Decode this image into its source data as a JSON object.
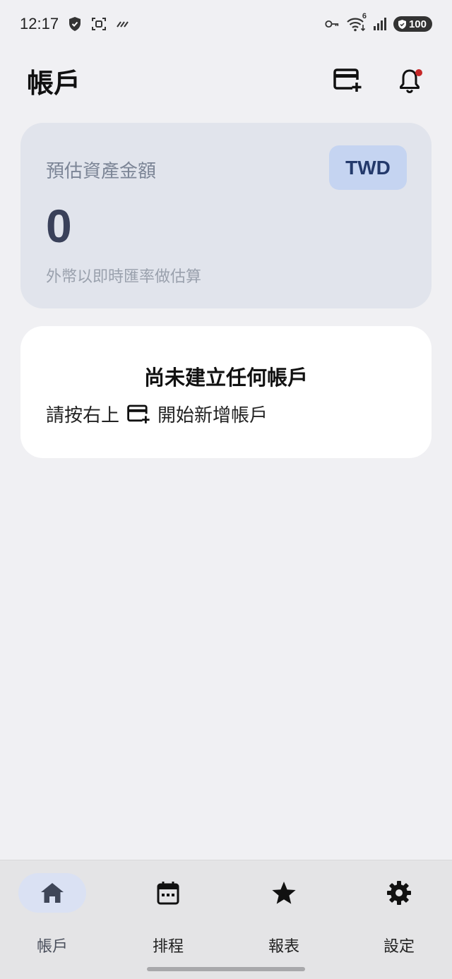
{
  "status_bar": {
    "time": "12:17",
    "battery": "100",
    "wifi_badge": "6",
    "icons": [
      "shield-icon",
      "screenshot-icon",
      "activity-icon",
      "vpn-key-icon",
      "wifi-icon",
      "signal-icon",
      "battery-icon"
    ]
  },
  "header": {
    "title": "帳戶",
    "add_account_icon": "add-card-icon",
    "notification_icon": "bell-icon",
    "notification_dot_color": "#c62828"
  },
  "asset_card": {
    "label": "預估資產金額",
    "currency": "TWD",
    "amount": "0",
    "note": "外幣以即時匯率做估算"
  },
  "empty_state": {
    "title": "尚未建立任何帳戶",
    "hint_before": "請按右上",
    "hint_icon": "add-card-icon",
    "hint_after": "開始新增帳戶"
  },
  "bottom_nav": {
    "items": [
      {
        "label": "帳戶",
        "icon": "home-icon",
        "active": true
      },
      {
        "label": "排程",
        "icon": "calendar-icon",
        "active": false
      },
      {
        "label": "報表",
        "icon": "star-icon",
        "active": false
      },
      {
        "label": "設定",
        "icon": "gear-icon",
        "active": false
      }
    ]
  },
  "colors": {
    "background": "#f0f0f3",
    "asset_card": "#e1e4ec",
    "currency_badge": "#c5d4f1",
    "currency_text": "#23396b",
    "nav_active": "#dae1f3"
  }
}
